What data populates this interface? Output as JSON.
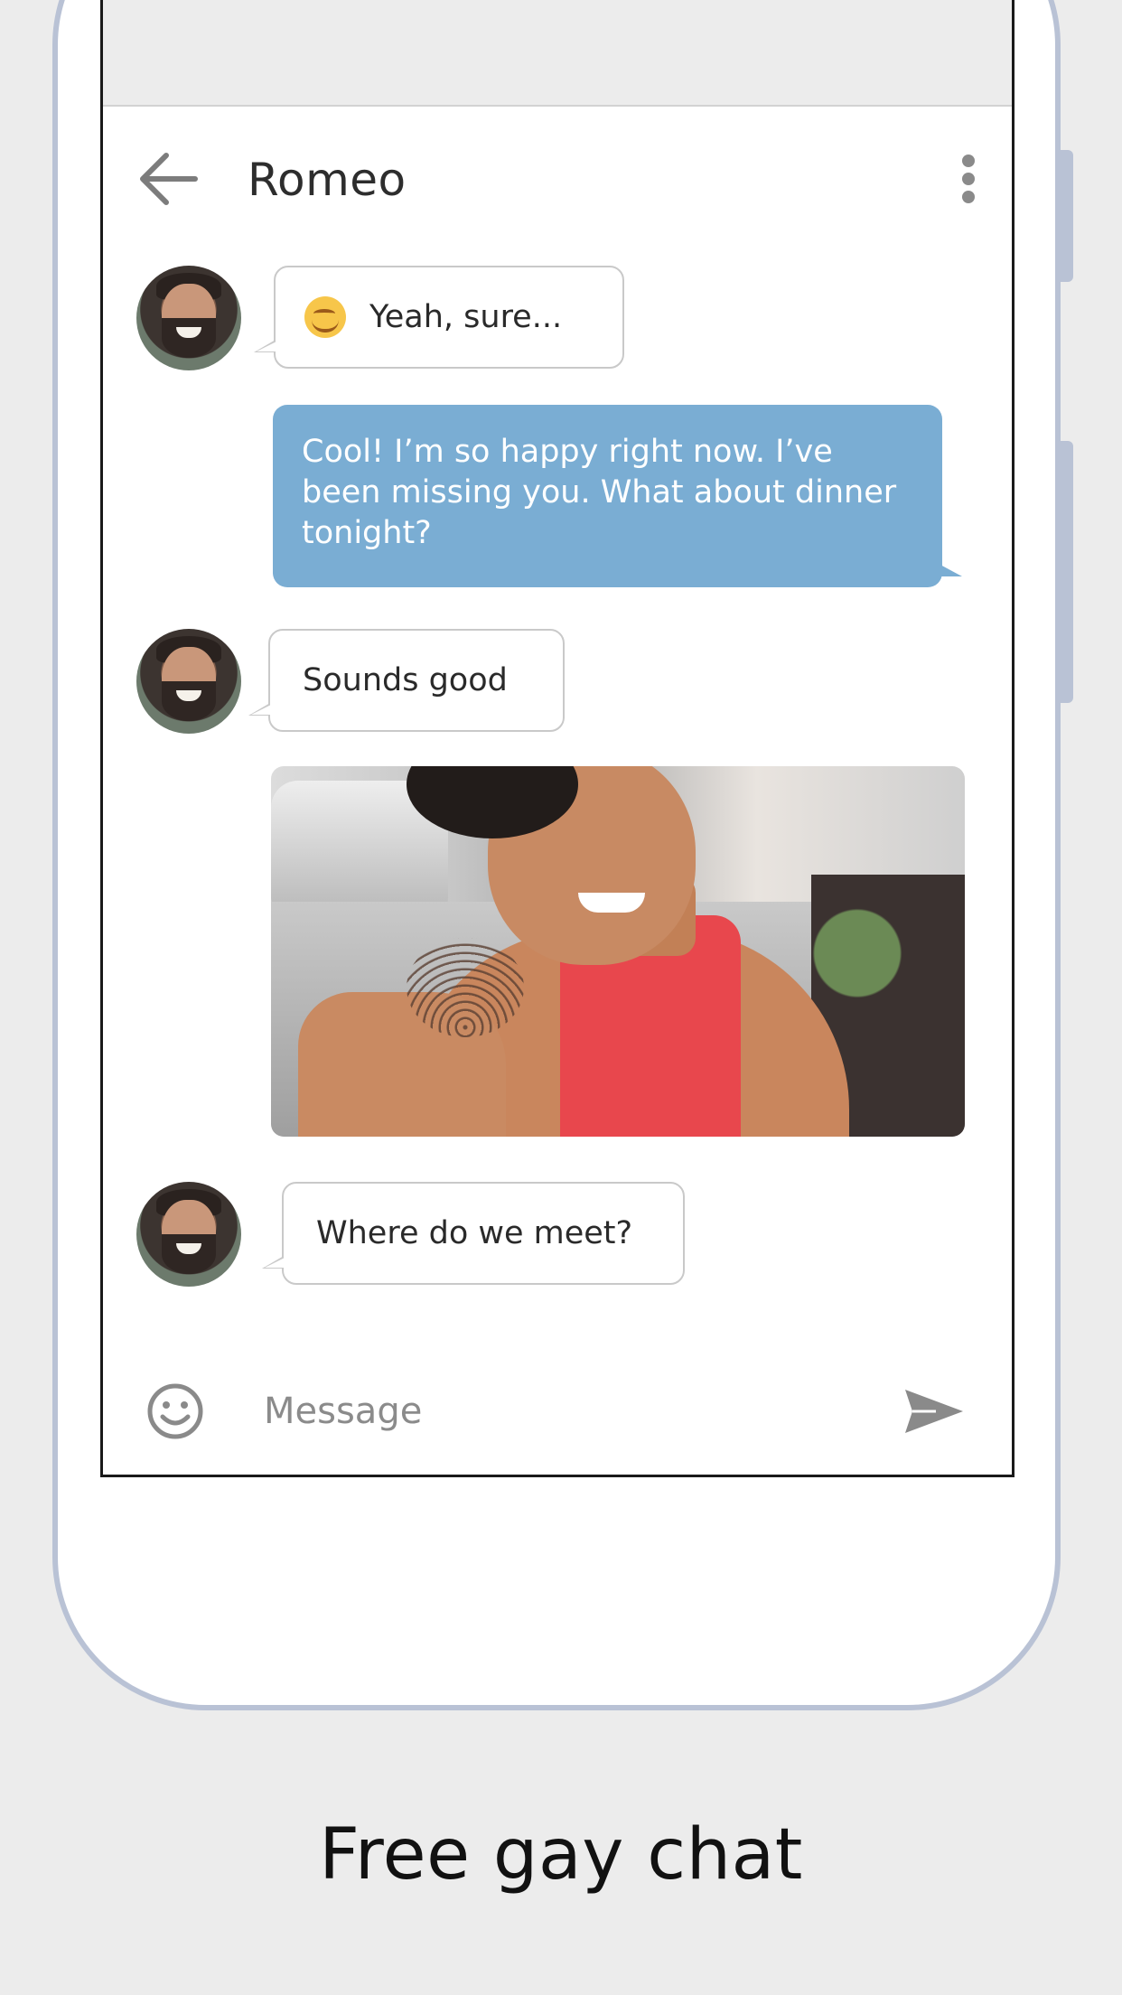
{
  "chat": {
    "title": "Romeo",
    "messages": [
      {
        "from": "them",
        "text": "Yeah, sure...",
        "emoji": "smiling-face"
      },
      {
        "from": "me",
        "text": "Cool! I’m so happy right now. I’ve been missing you. What about dinner tonight?"
      },
      {
        "from": "them",
        "text": "Sounds good"
      },
      {
        "from": "me",
        "type": "photo"
      },
      {
        "from": "them",
        "text": "Where do we meet?"
      }
    ]
  },
  "composer": {
    "placeholder": "Message"
  },
  "caption": "Free gay chat",
  "colors": {
    "outgoing_bubble": "#7aadd3",
    "phone_frame": "#b9c2d5",
    "background": "#ececec"
  }
}
